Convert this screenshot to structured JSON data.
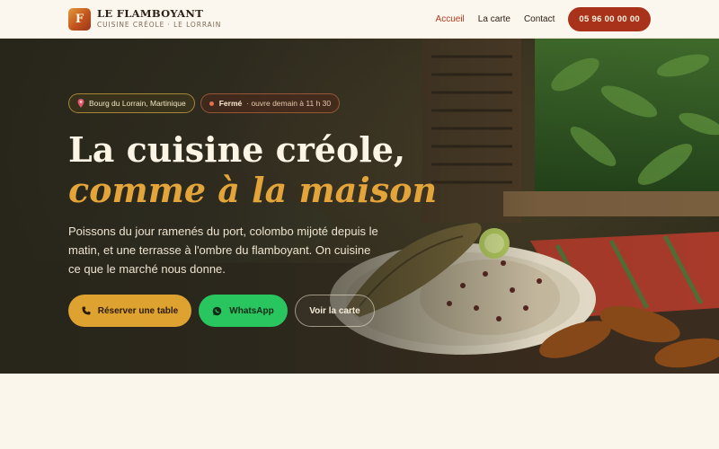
{
  "brand": {
    "logo_letter": "F",
    "name": "LE FLAMBOYANT",
    "tagline": "CUISINE CRÉOLE · LE LORRAIN"
  },
  "nav": {
    "items": [
      {
        "label": "Accueil",
        "active": true
      },
      {
        "label": "La carte",
        "active": false
      },
      {
        "label": "Contact",
        "active": false
      }
    ],
    "phone": "05 96 00 00 00"
  },
  "hero": {
    "location_badge": "Bourg du Lorrain, Martinique",
    "status": {
      "state": "Fermé",
      "note": "· ouvre demain à 11 h 30"
    },
    "title": "La cuisine créole,",
    "title_accent": "comme à la maison",
    "lede": "Poissons du jour ramenés du port, colombo mijoté depuis le matin, et une terrasse à l'ombre du flamboyant. On cuisine ce que le marché nous donne.",
    "buttons": {
      "reserve": "Réserver une table",
      "whatsapp": "WhatsApp",
      "menu": "Voir la carte"
    }
  },
  "colors": {
    "accent_red": "#a8331a",
    "accent_gold": "#dea231",
    "whatsapp_green": "#29c65f",
    "cream": "#fbf6ec"
  }
}
